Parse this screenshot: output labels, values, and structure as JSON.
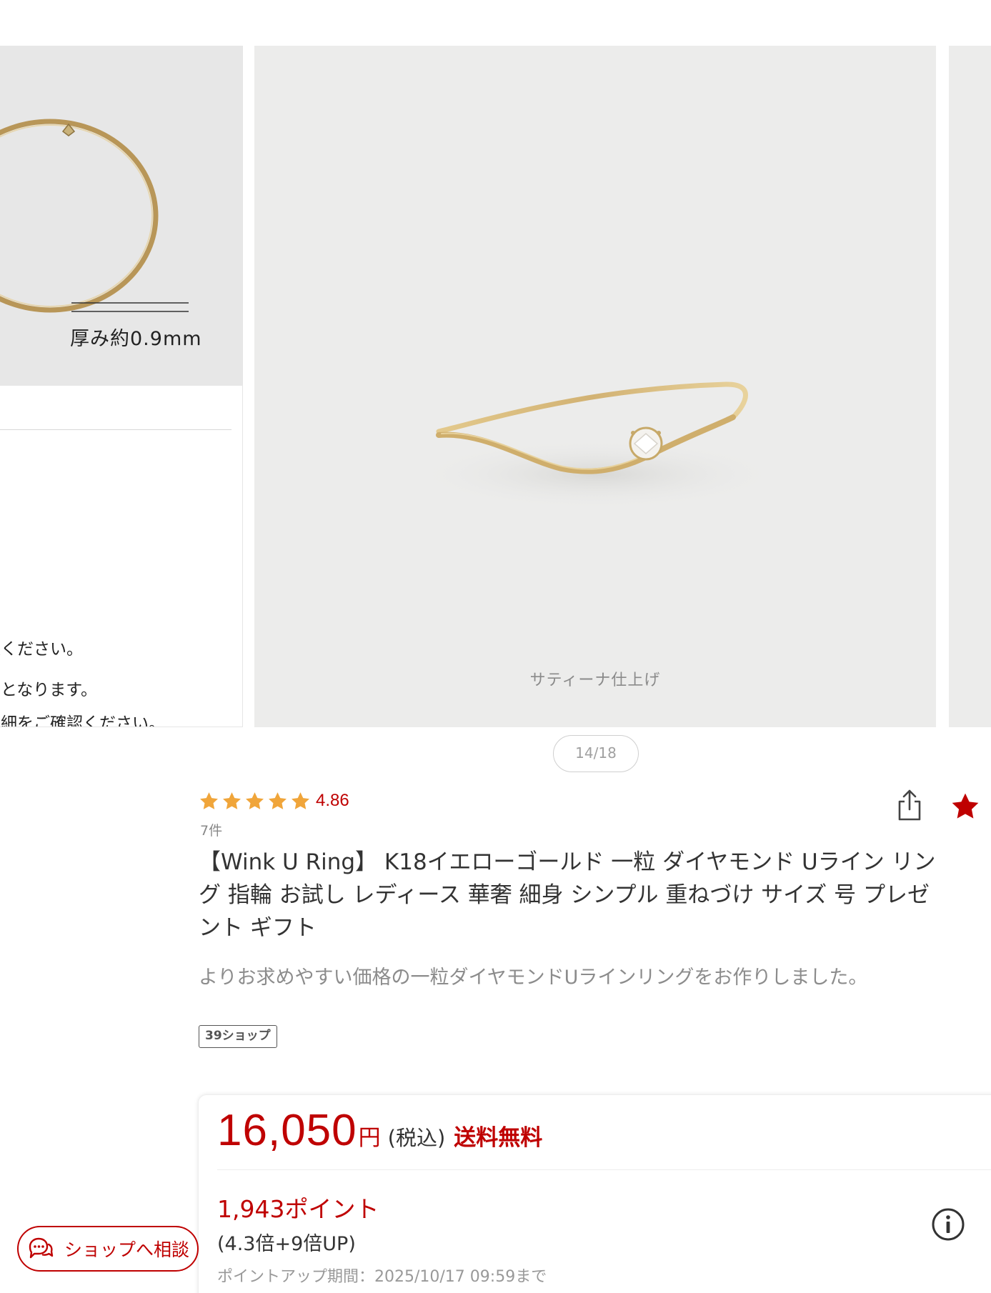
{
  "carousel": {
    "prev_slide": {
      "thickness_label": "厚み約0.9mm",
      "text_lines": [
        "談ください。",
        "荷となります。",
        "詳細をご確認ください。"
      ]
    },
    "main_slide": {
      "caption": "サティーナ仕上げ"
    },
    "page_indicator": "14/18"
  },
  "product": {
    "rating": {
      "stars": 5,
      "value": "4.86",
      "review_count": "7件"
    },
    "title_lines": [
      "【Wink U Ring】 K18イエローゴールド 一粒 ダイヤモンド Uライン リン",
      "グ 指輪 お試し レディース 華奢 細身 シンプル 重ねづけ サイズ 号 プレゼ",
      "ント ギフト"
    ],
    "catch_copy": "よりお求めやすい価格の一粒ダイヤモンドUラインリングをお作りしました。",
    "shop_badge": "39ショップ",
    "icons": {
      "share": "share-icon",
      "favorite": "star-icon",
      "info": "info-icon"
    }
  },
  "price": {
    "amount": "16,050",
    "currency": "円",
    "tax_label": "(税込)",
    "shipping": "送料無料",
    "points": "1,943ポイント",
    "points_multiplier": "(4.3倍+9倍UP)",
    "points_period": "ポイントアップ期間：2025/10/17 09:59まで"
  },
  "consult_button": {
    "label": "ショップへ相談",
    "icon": "chat-icon"
  },
  "colors": {
    "accent_red": "#bf0000",
    "star_gold": "#f0a53a",
    "photo_background": "#ececeb"
  }
}
